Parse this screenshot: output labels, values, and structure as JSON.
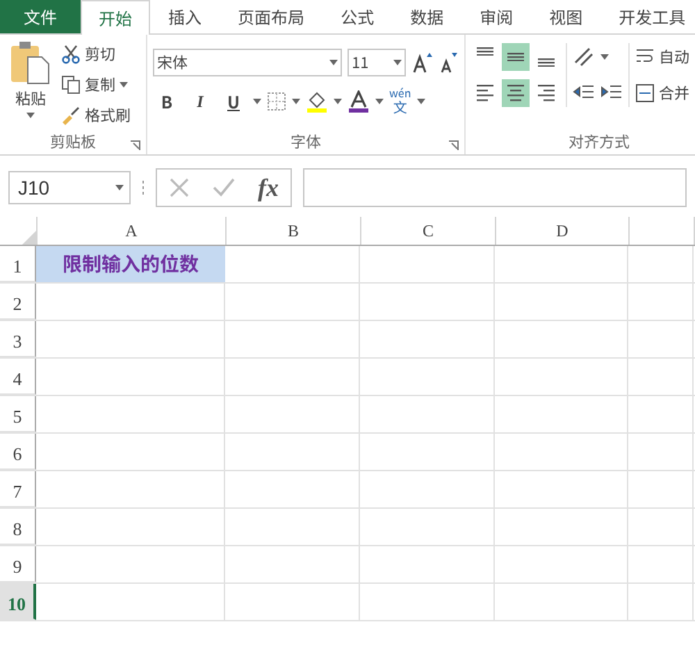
{
  "tabs": [
    {
      "label": "文件",
      "kind": "file",
      "selected": false
    },
    {
      "label": "开始",
      "kind": "tab",
      "selected": true
    },
    {
      "label": "插入",
      "kind": "tab",
      "selected": false
    },
    {
      "label": "页面布局",
      "kind": "tab",
      "selected": false
    },
    {
      "label": "公式",
      "kind": "tab",
      "selected": false
    },
    {
      "label": "数据",
      "kind": "tab",
      "selected": false
    },
    {
      "label": "审阅",
      "kind": "tab",
      "selected": false
    },
    {
      "label": "视图",
      "kind": "tab",
      "selected": false
    },
    {
      "label": "开发工具",
      "kind": "tab",
      "selected": false
    }
  ],
  "clipboard": {
    "paste": "粘贴",
    "cut": "剪切",
    "copy": "复制",
    "format_painter": "格式刷",
    "label": "剪贴板"
  },
  "font": {
    "font_name": "宋体",
    "font_size": "11",
    "bold": "B",
    "italic": "I",
    "underline": "U",
    "phonetic": "wén",
    "phonetic_char": "文",
    "label": "字体"
  },
  "alignment": {
    "vertical": [
      {
        "selected": false
      },
      {
        "selected": true
      },
      {
        "selected": false
      }
    ],
    "horizontal": [
      {
        "selected": false
      },
      {
        "selected": true
      },
      {
        "selected": false
      }
    ],
    "wrap": "自动",
    "merge": "合并",
    "label": "对齐方式"
  },
  "formula_bar": {
    "name_box": "J10",
    "fx": "fx"
  },
  "sheet": {
    "columns": [
      "A",
      "B",
      "C",
      "D"
    ],
    "rows": [
      {
        "number": "1",
        "selected": false,
        "cells": [
          {
            "text": "限制输入的位数",
            "highlighted": true
          }
        ]
      },
      {
        "number": "2",
        "selected": false,
        "cells": []
      },
      {
        "number": "3",
        "selected": false,
        "cells": []
      },
      {
        "number": "4",
        "selected": false,
        "cells": []
      },
      {
        "number": "5",
        "selected": false,
        "cells": []
      },
      {
        "number": "6",
        "selected": false,
        "cells": []
      },
      {
        "number": "7",
        "selected": false,
        "cells": []
      },
      {
        "number": "8",
        "selected": false,
        "cells": []
      },
      {
        "number": "9",
        "selected": false,
        "cells": []
      },
      {
        "number": "10",
        "selected": true,
        "cells": []
      }
    ]
  }
}
